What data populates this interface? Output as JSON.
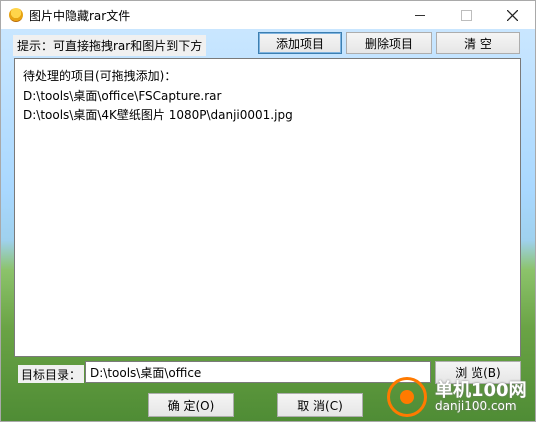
{
  "window": {
    "title": "图片中隐藏rar文件",
    "controls": {
      "minimize": "minimize",
      "maximize": "maximize",
      "close": "close"
    }
  },
  "toolbar": {
    "hint": "提示：可直接拖拽rar和图片到下方",
    "add_label": "添加项目",
    "delete_label": "删除项目",
    "clear_label": "清 空"
  },
  "list": {
    "header": "待处理的项目(可拖拽添加)：",
    "items": [
      "D:\\tools\\桌面\\office\\FSCapture.rar",
      "D:\\tools\\桌面\\4K壁纸图片 1080P\\danji0001.jpg"
    ]
  },
  "target": {
    "label": "目标目录：",
    "value": "D:\\tools\\桌面\\office",
    "browse_label": "浏 览(B)"
  },
  "footer": {
    "ok_label": "确 定(O)",
    "cancel_label": "取 消(C)"
  },
  "watermark": {
    "brand_cn": "单机100网",
    "url": "danji100.com"
  },
  "colors": {
    "accent": "#3c7fb1",
    "watermark": "#ff7a00"
  }
}
